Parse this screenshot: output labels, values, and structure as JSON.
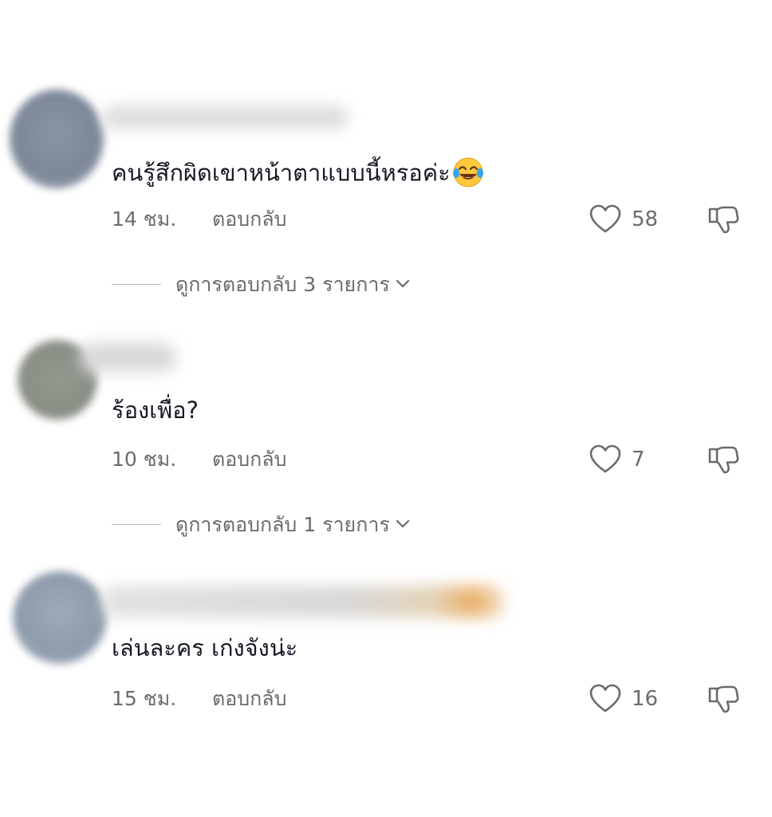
{
  "comments": [
    {
      "text": "คนรู้สึกผิดเขาหน้าตาแบบนี้หรอค่ะ",
      "emoji": "face-with-tears-of-joy-icon",
      "time": "14 ชม.",
      "reply_label": "ตอบกลับ",
      "likes": "58",
      "view_replies": "ดูการตอบกลับ 3 รายการ"
    },
    {
      "text": "ร้องเพื่อ?",
      "time": "10 ชม.",
      "reply_label": "ตอบกลับ",
      "likes": "7",
      "view_replies": "ดูการตอบกลับ 1 รายการ"
    },
    {
      "text": "เล่นละคร เก่งจังน่ะ",
      "time": "15 ชม.",
      "reply_label": "ตอบกลับ",
      "likes": "16"
    }
  ],
  "colors": {
    "text_primary": "#161823",
    "text_secondary": "#6b6b6b",
    "divider": "#b5b5b5",
    "background": "#ffffff"
  }
}
